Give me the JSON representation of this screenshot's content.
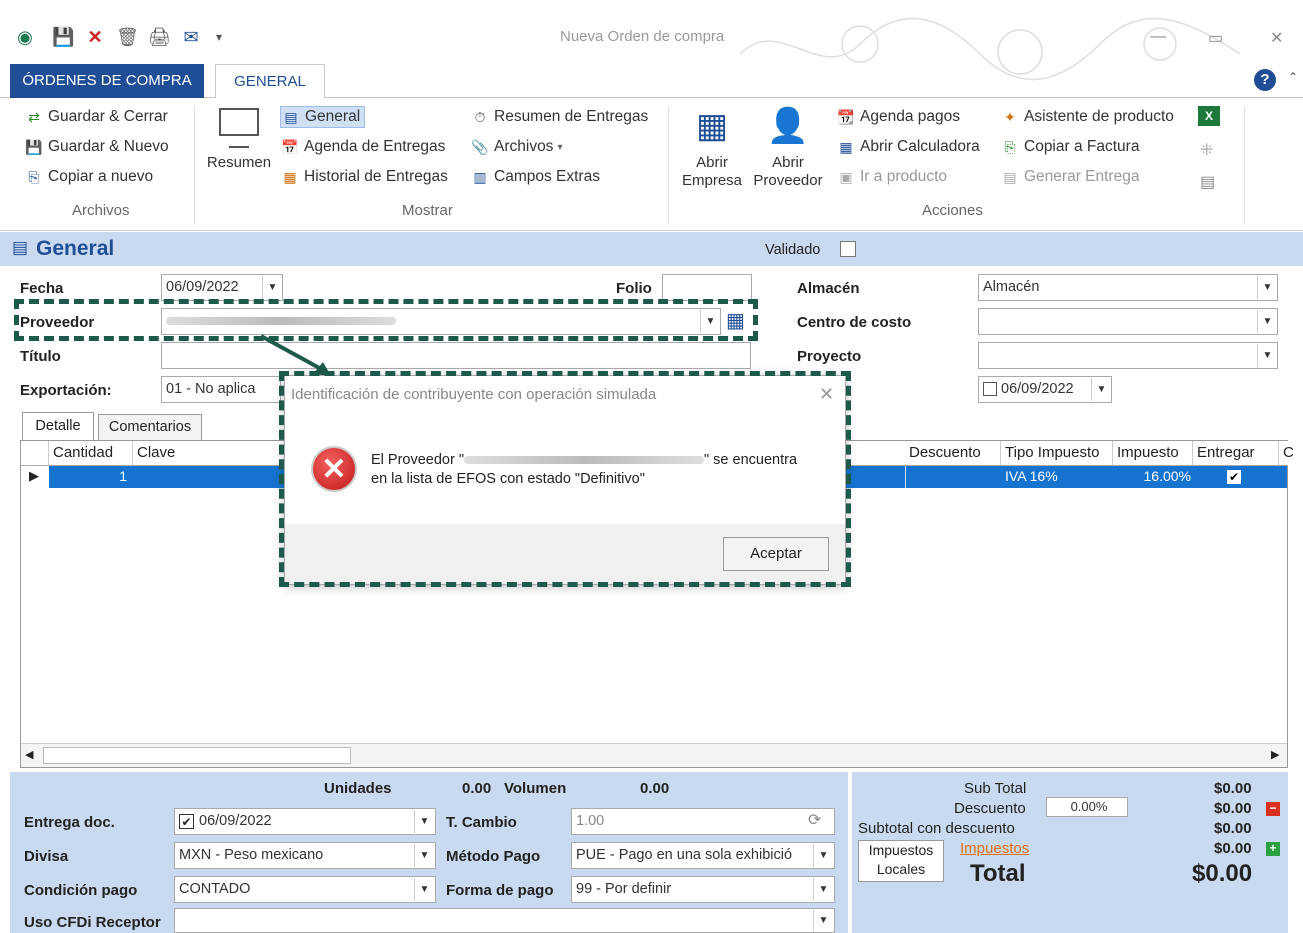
{
  "window": {
    "title": "Nueva Orden de compra"
  },
  "tabs": {
    "file": "ÓRDENES DE COMPRA",
    "general": "GENERAL"
  },
  "ribbon": {
    "archivos": {
      "guardar_cerrar": "Guardar & Cerrar",
      "guardar_nuevo": "Guardar & Nuevo",
      "copiar_nuevo": "Copiar a nuevo",
      "group": "Archivos"
    },
    "mostrar": {
      "resumen": "Resumen",
      "general": "General",
      "agenda_entregas": "Agenda de Entregas",
      "historial_entregas": "Historial de Entregas",
      "resumen_entregas": "Resumen de Entregas",
      "archivos": "Archivos",
      "campos_extras": "Campos Extras",
      "group": "Mostrar"
    },
    "acciones": {
      "abrir_empresa_1": "Abrir",
      "abrir_empresa_2": "Empresa",
      "abrir_proveedor_1": "Abrir",
      "abrir_proveedor_2": "Proveedor",
      "agenda_pagos": "Agenda pagos",
      "abrir_calculadora": "Abrir Calculadora",
      "ir_producto": "Ir a producto",
      "asistente_producto": "Asistente de producto",
      "copiar_factura": "Copiar a Factura",
      "generar_entrega": "Generar Entrega",
      "group": "Acciones"
    }
  },
  "section": {
    "title": "General",
    "validado": "Validado"
  },
  "form": {
    "fecha_label": "Fecha",
    "fecha": "06/09/2022",
    "folio_label": "Folio",
    "proveedor_label": "Proveedor",
    "titulo_label": "Título",
    "exportacion_label": "Exportación:",
    "exportacion": "01 - No aplica",
    "almacen_label": "Almacén",
    "almacen": "Almacén",
    "centro_label": "Centro de costo",
    "proyecto_label": "Proyecto",
    "fecha2": "06/09/2022"
  },
  "subtabs": {
    "detalle": "Detalle",
    "comentarios": "Comentarios"
  },
  "grid": {
    "headers": {
      "cantidad": "Cantidad",
      "clave": "Clave",
      "descuento": "Descuento",
      "tipo_impuesto": "Tipo Impuesto",
      "impuesto": "Impuesto",
      "entregar": "Entregar",
      "extra": "C"
    },
    "row": {
      "cantidad": "1",
      "tipo_impuesto": "IVA 16%",
      "impuesto": "16.00%"
    }
  },
  "footer": {
    "unidades_label": "Unidades",
    "unidades": "0.00",
    "volumen_label": "Volumen",
    "volumen": "0.00",
    "entrega_label": "Entrega doc.",
    "entrega": "06/09/2022",
    "tcambio_label": "T. Cambio",
    "tcambio": "1.00",
    "divisa_label": "Divisa",
    "divisa": "MXN - Peso mexicano",
    "metodo_label": "Método Pago",
    "metodo": "PUE - Pago en una sola exhibició",
    "condicion_label": "Condición pago",
    "condicion": "CONTADO",
    "forma_label": "Forma de pago",
    "forma": "99 - Por definir",
    "uso_label": "Uso CFDi Receptor"
  },
  "totals": {
    "subtotal_label": "Sub Total",
    "subtotal": "$0.00",
    "descuento_label": "Descuento",
    "descuento_pct": "0.00%",
    "descuento": "$0.00",
    "subtotal_desc_label": "Subtotal con descuento",
    "subtotal_desc": "$0.00",
    "impuestos_link": "Impuestos",
    "impuestos": "$0.00",
    "impuestos_locales_1": "Impuestos",
    "impuestos_locales_2": "Locales",
    "total_label": "Total",
    "total": "$0.00"
  },
  "dialog": {
    "title": "Identificación de contribuyente con operación simulada",
    "msg_pre": "El Proveedor \"",
    "msg_post": "\" se encuentra",
    "msg_line2": "en la lista de EFOS con estado \"Definitivo\"",
    "ok": "Aceptar"
  },
  "colors": {
    "brand": "#1f4e96",
    "section": "#c9daf0",
    "selection": "#1673d0",
    "highlight": "#1e5a4b"
  }
}
